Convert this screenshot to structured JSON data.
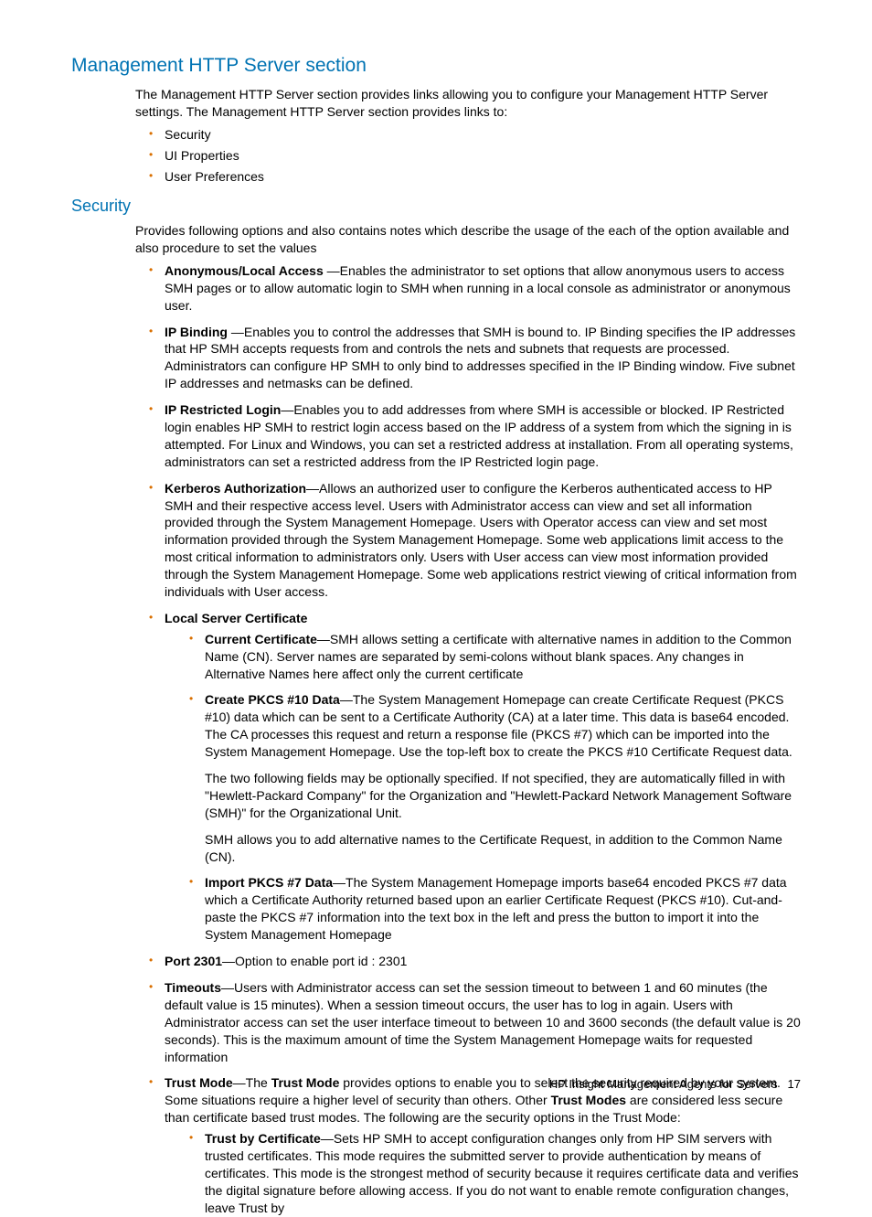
{
  "headings": {
    "h1": "Management HTTP Server section",
    "h2": "Security"
  },
  "intro": {
    "p1": "The Management HTTP Server section provides links allowing you to configure your Management HTTP Server settings. The Management HTTP Server section provides links to:"
  },
  "introList": [
    "Security",
    "UI Properties",
    "User Preferences"
  ],
  "securityIntro": "Provides following options and also contains notes which describe the usage of the each of the option available and also procedure to set the values",
  "items": {
    "anonymous": {
      "title": "Anonymous/Local Access ",
      "body": "—Enables the administrator to set options that allow anonymous users to access SMH pages or to allow automatic login to SMH when running in a local console as administrator or anonymous user."
    },
    "ipBinding": {
      "title": "IP Binding ",
      "body": "—Enables you to control the addresses that SMH is bound to. IP Binding specifies the IP addresses that HP SMH accepts requests from and controls the nets and subnets that requests are processed. Administrators can configure HP SMH to only bind to addresses specified in the IP Binding window. Five subnet IP addresses and netmasks can be defined."
    },
    "ipRestricted": {
      "title": "IP Restricted Login",
      "body": "—Enables you to add addresses from where SMH is accessible or blocked. IP Restricted login enables HP SMH to restrict login access based on the IP address of a system from which the signing in is attempted. For Linux and Windows, you can set a restricted address at installation. From all operating systems, administrators can set a restricted address from the IP Restricted login page."
    },
    "kerberos": {
      "title": "Kerberos Authorization",
      "body": "—Allows an authorized user to configure the Kerberos authenticated access to HP SMH and their respective access level. Users with Administrator access can view and set all information provided through the System Management Homepage. Users with Operator access can view and set most information provided through the System Management Homepage. Some web applications limit access to the most critical information to administrators only. Users with User access can view most information provided through the System Management Homepage. Some web applications restrict viewing of critical information from individuals with User access."
    },
    "localCert": {
      "title": "Local Server Certificate"
    },
    "currentCert": {
      "title": "Current Certificate",
      "body": "—SMH allows setting a certificate with alternative names in addition to the Common Name (CN). Server names are separated by semi-colons without blank spaces. Any changes in Alternative Names here affect only the current certificate"
    },
    "createPkcs10": {
      "title": "Create PKCS #10 Data",
      "body": "—The System Management Homepage can create Certificate Request (PKCS #10) data which can be sent to a Certificate Authority (CA) at a later time. This data is base64 encoded. The CA processes this request and return a response file (PKCS #7) which can be imported into the System Management Homepage. Use the top-left box to create the PKCS #10 Certificate Request data.",
      "extra1": "The two following fields may be optionally specified. If not specified, they are automatically filled in with \"Hewlett-Packard Company\" for the Organization and \"Hewlett-Packard Network Management Software (SMH)\" for the Organizational Unit.",
      "extra2": "SMH allows you to add alternative names to the Certificate Request, in addition to the Common Name (CN)."
    },
    "importPkcs7": {
      "title": "Import PKCS #7 Data",
      "body": "—The System Management Homepage imports base64 encoded PKCS #7 data which a Certificate Authority returned based upon an earlier Certificate Request (PKCS #10). Cut-and-paste the PKCS #7 information into the text box in the left and press the button to import it into the System Management Homepage"
    },
    "port2301": {
      "title": "Port 2301",
      "body": "—Option to enable port id : 2301"
    },
    "timeouts": {
      "title": "Timeouts",
      "body": "—Users with Administrator access can set the session timeout to between 1 and 60 minutes (the default value is 15 minutes). When a session timeout occurs, the user has to log in again.  Users with Administrator access can set the user interface timeout to between 10 and 3600 seconds (the default value is 20 seconds). This is the maximum amount of time the System Management Homepage waits for requested information"
    },
    "trustMode": {
      "title": "Trust Mode",
      "pre": "—The ",
      "bold2": "Trust Mode",
      "mid": " provides options to enable you to select the security required by your system. Some situations require a higher level of security than others. Other ",
      "bold3": "Trust Modes",
      "post": " are considered less secure than certificate based trust modes. The following are the security options in the Trust Mode:"
    },
    "trustByCert": {
      "title": "Trust by Certificate",
      "body": "—Sets HP SMH to accept configuration changes only from HP SIM servers with trusted certificates. This mode requires the submitted server to provide authentication by means of certificates. This mode is the strongest method of security because it requires certificate data and verifies the digital signature before allowing access. If you do not want to enable remote configuration changes, leave Trust by"
    }
  },
  "footer": {
    "text": "HP Insight Management Agents for Servers",
    "page": "17"
  }
}
